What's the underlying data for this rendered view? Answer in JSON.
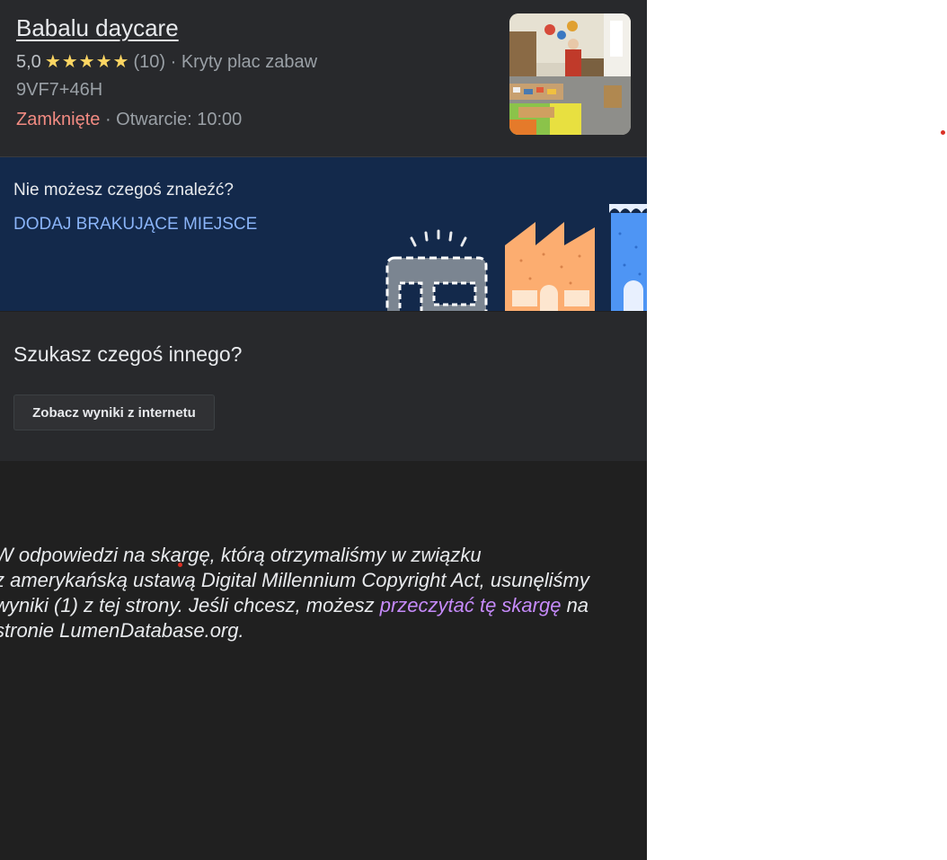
{
  "place": {
    "name": "Babalu daycare",
    "rating": "5,0",
    "stars": "★★★★★",
    "review_count": "(10)",
    "separator": "·",
    "category": "Kryty plac zabaw",
    "plus_code": "9VF7+46H",
    "status": "Zamknięte",
    "opening": "Otwarcie: 10:00"
  },
  "add_place": {
    "question": "Nie możesz czegoś znaleźć?",
    "link": "DODAJ BRAKUJĄCE MIEJSCE"
  },
  "search_else": {
    "title": "Szukasz czegoś innego?",
    "button": "Zobacz wyniki z internetu"
  },
  "dmca": {
    "line1": "W odpowiedzi na skargę, którą otrzymaliśmy w związku",
    "line2": "z amerykańską ustawą Digital Millennium Copyright Act, usunęliśmy",
    "line3_before": "wyniki (1) z tej strony. Jeśli chcesz, możesz ",
    "link": "przeczytać tę skargę",
    "line3_after": " na",
    "line4": "stronie LumenDatabase.org."
  },
  "colors": {
    "star": "#fdd663",
    "closed": "#f28b82",
    "link_blue": "#8ab4f8",
    "link_purple": "#c58af9",
    "banner_bg": "#13294b"
  }
}
